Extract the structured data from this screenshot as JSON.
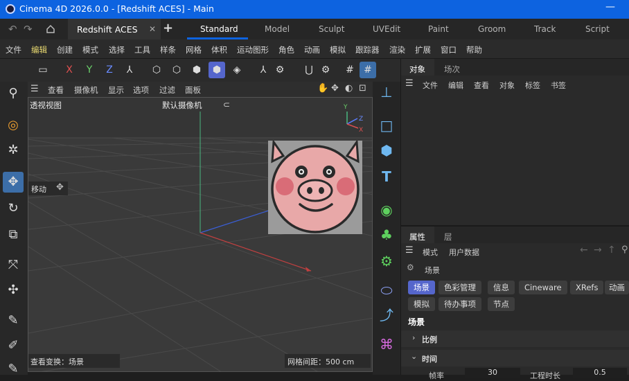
{
  "window": {
    "title": "Cinema 4D 2026.0.0 - [Redshift ACES] - Main",
    "minimize": "—"
  },
  "tabbar": {
    "doc_tab": "Redshift ACES",
    "close": "✕",
    "add": "+",
    "layouts": [
      "Standard",
      "Model",
      "Sculpt",
      "UVEdit",
      "Paint",
      "Groom",
      "Track",
      "Script"
    ]
  },
  "menu": [
    "文件",
    "编辑",
    "创建",
    "模式",
    "选择",
    "工具",
    "样条",
    "网格",
    "体积",
    "运动图形",
    "角色",
    "动画",
    "模拟",
    "跟踪器",
    "渲染",
    "扩展",
    "窗口",
    "帮助"
  ],
  "toolbar": {
    "axes": [
      "X",
      "Y",
      "Z"
    ]
  },
  "viewport": {
    "menu": [
      "查看",
      "摄像机",
      "显示",
      "选项",
      "过滤",
      "面板"
    ],
    "view_name": "透视视图",
    "camera": "默认摄像机",
    "tool_label": "移动",
    "status_left": "查看变换：场景",
    "status_right": "网格间距：500 cm",
    "axis_labels": {
      "x": "X",
      "y": "Y",
      "z": "Z"
    }
  },
  "objects_panel": {
    "tabs": [
      "对象",
      "场次"
    ],
    "menu": [
      "文件",
      "编辑",
      "查看",
      "对象",
      "标签",
      "书签"
    ]
  },
  "attributes_panel": {
    "tabs": [
      "属性",
      "层"
    ],
    "menu": [
      "模式",
      "用户数据"
    ],
    "context": "场景",
    "pills_row1": [
      "场景",
      "色彩管理",
      "信息",
      "Cineware",
      "XRefs",
      "动画"
    ],
    "pills_row2": [
      "模拟",
      "待办事项",
      "节点"
    ],
    "section": "场景",
    "groups": [
      "比例",
      "时间"
    ],
    "field_fps_label": "帧率",
    "field_fps_value": "30",
    "field_duration_label": "工程时长",
    "field_duration_value": "0.5"
  },
  "colors": {
    "accent": "#0d63e0",
    "active_pill": "#5566cc",
    "x_axis": "#e05050",
    "y_axis": "#6ad06a",
    "z_axis": "#5a7cff"
  }
}
